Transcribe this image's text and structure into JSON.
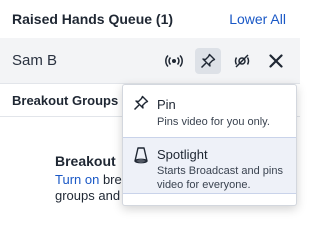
{
  "header": {
    "title": "Raised Hands Queue (1)",
    "lower_all": "Lower All"
  },
  "queue": {
    "items": [
      {
        "name": "Sam B"
      }
    ],
    "actions": {
      "broadcast_icon": "broadcast-icon",
      "pin_icon": "pin-icon",
      "spotlight_icon": "spotlight-icon",
      "close_icon": "close-icon"
    }
  },
  "breakout": {
    "title": "Breakout Groups (",
    "empty_heading": "Breakout",
    "empty_link": "Turn on",
    "empty_line1_rest": " bre",
    "empty_line2": "groups and g"
  },
  "menu": {
    "items": [
      {
        "label": "Pin",
        "description": "Pins video for you only.",
        "icon": "pin-icon"
      },
      {
        "label": "Spotlight",
        "description": "Starts Broadcast and pins video for everyone.",
        "icon": "spotlight-icon"
      }
    ]
  },
  "colors": {
    "accent": "#1a58c6",
    "row_background": "#f3f4f6",
    "active_button": "#dde1e7",
    "highlight_item": "#eef1f8"
  }
}
